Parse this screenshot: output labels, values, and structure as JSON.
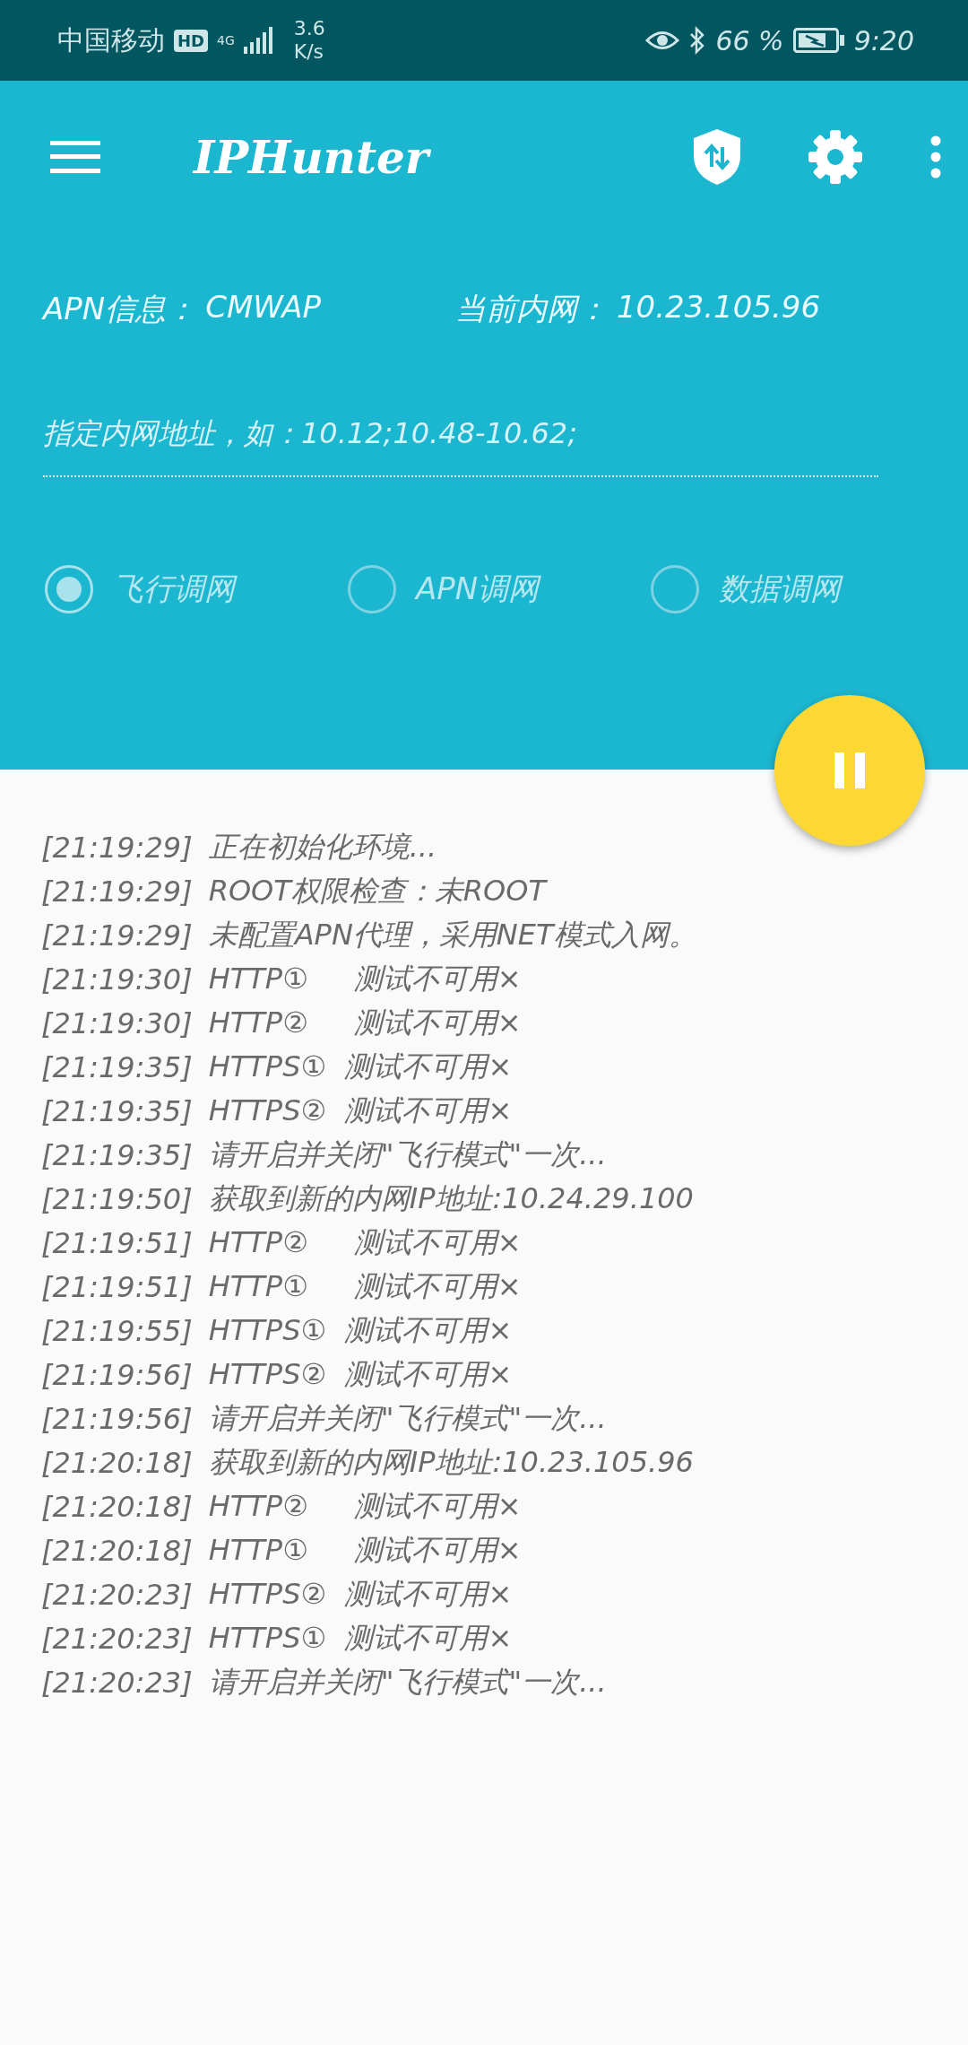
{
  "status_bar": {
    "carrier": "中国移动",
    "hd": "HD",
    "network": "4G",
    "speed_value": "3.6",
    "speed_unit": "K/s",
    "battery_percent": "66 %",
    "time": "9:20"
  },
  "toolbar": {
    "title": "IPHunter"
  },
  "info": {
    "apn_label": "APN信息：",
    "apn_value": "CMWAP",
    "ip_label": "当前内网：",
    "ip_value": "10.23.105.96"
  },
  "address_field": {
    "placeholder": "指定内网地址，如：10.12;10.48-10.62;"
  },
  "modes": [
    {
      "label": "飞行调网",
      "selected": true
    },
    {
      "label": "APN调网",
      "selected": false
    },
    {
      "label": "数据调网",
      "selected": false
    }
  ],
  "log": [
    {
      "time": "[21:19:29]",
      "message": "正在初始化环境..."
    },
    {
      "time": "[21:19:29]",
      "message": "ROOT权限检查：未ROOT"
    },
    {
      "time": "[21:19:29]",
      "message": "未配置APN代理，采用NET模式入网。"
    },
    {
      "time": "[21:19:30]",
      "message": "HTTP①     测试不可用×"
    },
    {
      "time": "[21:19:30]",
      "message": "HTTP②     测试不可用×"
    },
    {
      "time": "[21:19:35]",
      "message": "HTTPS①  测试不可用×"
    },
    {
      "time": "[21:19:35]",
      "message": "HTTPS②  测试不可用×"
    },
    {
      "time": "[21:19:35]",
      "message": "请开启并关闭\"飞行模式\"一次..."
    },
    {
      "time": "[21:19:50]",
      "message": "获取到新的内网IP地址:10.24.29.100"
    },
    {
      "time": "[21:19:51]",
      "message": "HTTP②     测试不可用×"
    },
    {
      "time": "[21:19:51]",
      "message": "HTTP①     测试不可用×"
    },
    {
      "time": "[21:19:55]",
      "message": "HTTPS①  测试不可用×"
    },
    {
      "time": "[21:19:56]",
      "message": "HTTPS②  测试不可用×"
    },
    {
      "time": "[21:19:56]",
      "message": "请开启并关闭\"飞行模式\"一次..."
    },
    {
      "time": "[21:20:18]",
      "message": "获取到新的内网IP地址:10.23.105.96"
    },
    {
      "time": "[21:20:18]",
      "message": "HTTP②     测试不可用×"
    },
    {
      "time": "[21:20:18]",
      "message": "HTTP①     测试不可用×"
    },
    {
      "time": "[21:20:23]",
      "message": "HTTPS②  测试不可用×"
    },
    {
      "time": "[21:20:23]",
      "message": "HTTPS①  测试不可用×"
    },
    {
      "time": "[21:20:23]",
      "message": "请开启并关闭\"飞行模式\"一次..."
    }
  ]
}
